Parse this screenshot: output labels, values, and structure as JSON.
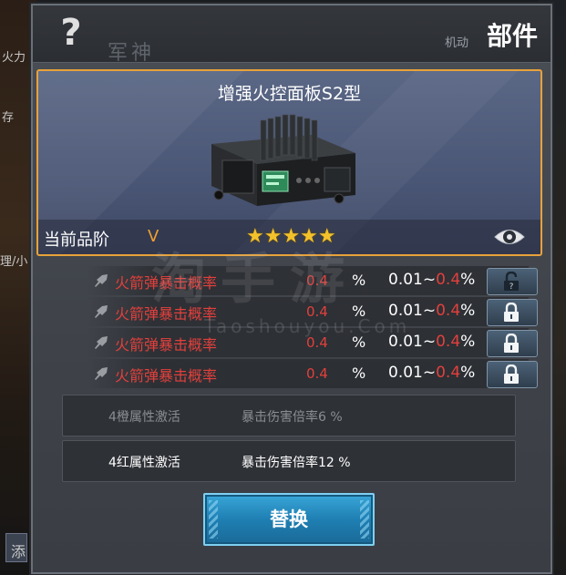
{
  "background": {
    "left_fragments": [
      "火力",
      "存",
      "理/小",
      "添"
    ],
    "right_fragment": ""
  },
  "header": {
    "help_icon": "question-icon",
    "title": "部件",
    "sub_label": "机动",
    "faint_text": "军神"
  },
  "item": {
    "name": "增强火控面板S2型",
    "quality_label": "当前品阶",
    "quality_value": "V",
    "stars": "★★★★★",
    "star_count": 5,
    "eye_icon": "eye-icon"
  },
  "attributes": [
    {
      "name": "火箭弹暴击概率",
      "value": "0.4",
      "unit": "%",
      "range_low": "0.01~",
      "range_high": "0.4",
      "range_unit": "%",
      "lock": "unlocked"
    },
    {
      "name": "火箭弹暴击概率",
      "value": "0.4",
      "unit": "%",
      "range_low": "0.01~",
      "range_high": "0.4",
      "range_unit": "%",
      "lock": "locked"
    },
    {
      "name": "火箭弹暴击概率",
      "value": "0.4",
      "unit": "%",
      "range_low": "0.01~",
      "range_high": "0.4",
      "range_unit": "%",
      "lock": "locked"
    },
    {
      "name": "火箭弹暴击概率",
      "value": "0.4",
      "unit": "%",
      "range_low": "0.01~",
      "range_high": "0.4",
      "range_unit": "%",
      "lock": "locked"
    }
  ],
  "set_bonuses": [
    {
      "title": "4橙属性激活",
      "desc": "暴击伤害倍率6 %",
      "active": false
    },
    {
      "title": "4红属性激活",
      "desc": "暴击伤害倍率12 %",
      "active": true
    }
  ],
  "replace_button": "替换",
  "watermark": {
    "big": "淘手游",
    "small": "Taoshouyou.Com"
  },
  "colors": {
    "accent_orange": "#e8a23a",
    "attr_red": "#e2403c",
    "star_gold": "#f3c12b",
    "button_blue": "#1f7fb3"
  }
}
